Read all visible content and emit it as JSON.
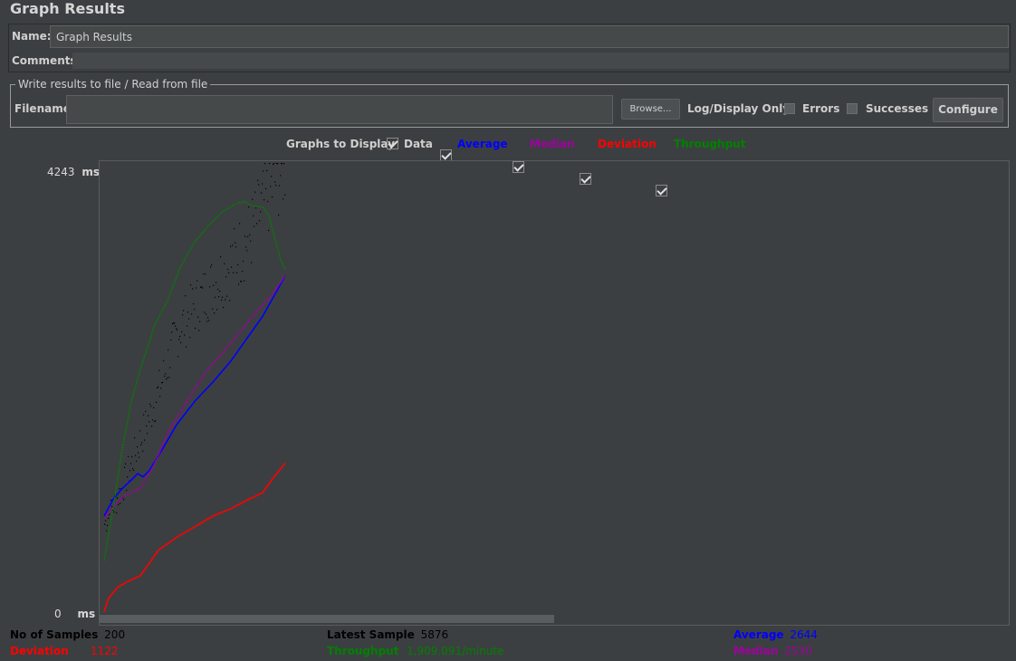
{
  "title": "Graph Results",
  "name_label": "Name:",
  "name_value": "Graph Results",
  "comments_label": "Comments:",
  "file_section": {
    "legend": "Write results to file / Read from file",
    "filename_label": "Filename",
    "filename_value": "",
    "browse_label": "Browse...",
    "log_display_label": "Log/Display Only:",
    "errors_label": "Errors",
    "successes_label": "Successes",
    "configure_label": "Configure"
  },
  "graphs_to_display": {
    "label": "Graphs to Display",
    "options": [
      {
        "label": "Data",
        "checked": true,
        "color": "#000000"
      },
      {
        "label": "Average",
        "checked": true,
        "color": "#0000ff"
      },
      {
        "label": "Median",
        "checked": true,
        "color": "#a000a0"
      },
      {
        "label": "Deviation",
        "checked": true,
        "color": "#ff0000"
      },
      {
        "label": "Throughput",
        "checked": true,
        "color": "#008000"
      }
    ]
  },
  "chart_data": {
    "type": "line",
    "ylabel_top": "4243",
    "ylabel_bottom": "0",
    "unit": "ms",
    "ylim": [
      0,
      4243
    ],
    "samples": 200,
    "series": [
      {
        "name": "Average",
        "color": "#0000ff",
        "points": [
          [
            0,
            920
          ],
          [
            10,
            1080
          ],
          [
            20,
            1180
          ],
          [
            30,
            1260
          ],
          [
            37,
            1320
          ],
          [
            43,
            1290
          ],
          [
            50,
            1350
          ],
          [
            65,
            1560
          ],
          [
            80,
            1780
          ],
          [
            100,
            2000
          ],
          [
            120,
            2180
          ],
          [
            140,
            2380
          ],
          [
            160,
            2620
          ],
          [
            175,
            2800
          ],
          [
            200,
            3180
          ]
        ]
      },
      {
        "name": "Median",
        "color": "#a000a0",
        "points": [
          [
            0,
            900
          ],
          [
            10,
            1000
          ],
          [
            20,
            1100
          ],
          [
            40,
            1180
          ],
          [
            55,
            1400
          ],
          [
            70,
            1700
          ],
          [
            90,
            1980
          ],
          [
            110,
            2250
          ],
          [
            130,
            2450
          ],
          [
            150,
            2650
          ],
          [
            170,
            2860
          ],
          [
            185,
            3000
          ],
          [
            200,
            3180
          ]
        ]
      },
      {
        "name": "Deviation",
        "color": "#ff0000",
        "points": [
          [
            0,
            20
          ],
          [
            5,
            150
          ],
          [
            15,
            250
          ],
          [
            25,
            300
          ],
          [
            40,
            360
          ],
          [
            50,
            480
          ],
          [
            60,
            600
          ],
          [
            80,
            720
          ],
          [
            100,
            820
          ],
          [
            120,
            920
          ],
          [
            140,
            990
          ],
          [
            160,
            1080
          ],
          [
            175,
            1140
          ],
          [
            185,
            1260
          ],
          [
            200,
            1420
          ]
        ]
      },
      {
        "name": "Throughput",
        "color": "#008000",
        "points": [
          [
            0,
            500
          ],
          [
            10,
            1000
          ],
          [
            20,
            1550
          ],
          [
            30,
            2000
          ],
          [
            40,
            2300
          ],
          [
            55,
            2700
          ],
          [
            70,
            2950
          ],
          [
            85,
            3280
          ],
          [
            100,
            3500
          ],
          [
            115,
            3650
          ],
          [
            130,
            3780
          ],
          [
            145,
            3860
          ],
          [
            155,
            3880
          ],
          [
            165,
            3840
          ],
          [
            175,
            3830
          ],
          [
            182,
            3750
          ],
          [
            188,
            3550
          ],
          [
            195,
            3330
          ],
          [
            200,
            3240
          ]
        ]
      }
    ],
    "data_trend": [
      [
        0,
        850
      ],
      [
        20,
        1200
      ],
      [
        40,
        1650
      ],
      [
        60,
        2100
      ],
      [
        80,
        2650
      ],
      [
        100,
        2900
      ],
      [
        120,
        3100
      ],
      [
        140,
        3300
      ],
      [
        160,
        3550
      ],
      [
        175,
        3850
      ],
      [
        190,
        4100
      ],
      [
        200,
        4243
      ]
    ],
    "samples_visible_fraction": 0.2
  },
  "stats": {
    "no_of_samples_label": "No of Samples",
    "no_of_samples_value": "200",
    "latest_sample_label": "Latest Sample",
    "latest_sample_value": "5876",
    "average_label": "Average",
    "average_value": "2644",
    "deviation_label": "Deviation",
    "deviation_value": "1122",
    "throughput_label": "Throughput",
    "throughput_value": "1,909.091/minute",
    "median_label": "Median",
    "median_value": "2530"
  },
  "colors": {
    "average": "#0000ff",
    "median": "#a000a0",
    "deviation": "#ff0000",
    "throughput": "#008000",
    "data": "#000000"
  }
}
